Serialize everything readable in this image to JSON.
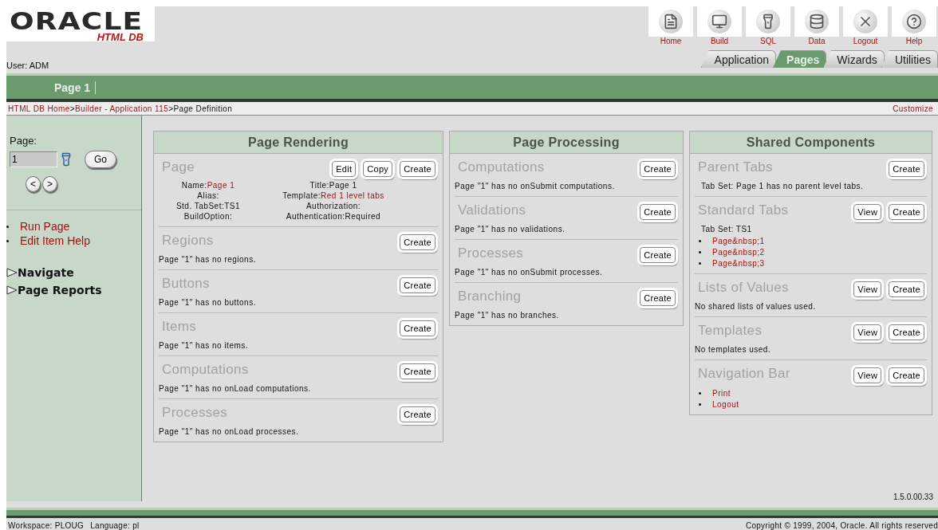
{
  "logo": {
    "word": "ORACLE",
    "product": "HTML DB"
  },
  "user": "User: ADM",
  "toolbar": [
    {
      "label": "Home"
    },
    {
      "label": "Build"
    },
    {
      "label": "SQL"
    },
    {
      "label": "Data"
    },
    {
      "label": "Logout"
    },
    {
      "label": "Help"
    }
  ],
  "tabs": [
    {
      "label": "Application",
      "selected": false
    },
    {
      "label": "Pages",
      "selected": true
    },
    {
      "label": "Wizards",
      "selected": false
    },
    {
      "label": "Utilities",
      "selected": false
    }
  ],
  "page_tab": "Page 1",
  "breadcrumb": [
    {
      "label": "HTML DB Home",
      "link": true
    },
    {
      "label": ">",
      "link": false
    },
    {
      "label": "Builder - Application 115",
      "link": true
    },
    {
      "label": ">Page Definition",
      "link": false
    }
  ],
  "customize": "Customize",
  "sidebar": {
    "page_label": "Page:",
    "page_value": "1",
    "go": "Go",
    "prev": "<",
    "next": ">",
    "links": [
      "Run Page",
      "Edit Item Help"
    ],
    "sections": [
      {
        "label": "Navigate",
        "expanded": false
      },
      {
        "label": "Page Reports",
        "expanded": false
      }
    ]
  },
  "panels": [
    {
      "title": "Page Rendering",
      "sections": [
        {
          "title": "Page",
          "buttons": [
            "Edit",
            "Copy",
            "Create"
          ],
          "fields": [
            {
              "label": "Name:",
              "value": "Page 1",
              "link": true
            },
            {
              "label": "Title:",
              "value": "Page 1",
              "link": false
            },
            {
              "label": "Alias:"
            },
            {
              "label": "Template:",
              "value": "Red 1 level tabs",
              "link": true
            },
            {
              "label": "Std. TabSet:",
              "value": "TS1",
              "link": false
            },
            {
              "label": "Authorization:"
            },
            {
              "label": "BuildOption:"
            },
            {
              "label": "Authentication:",
              "value": "Required",
              "link": false
            }
          ]
        },
        {
          "title": "Regions",
          "buttons": [
            "Create"
          ],
          "text": "Page \"1\" has no regions."
        },
        {
          "title": "Buttons",
          "buttons": [
            "Create"
          ],
          "text": "Page \"1\" has no buttons."
        },
        {
          "title": "Items",
          "buttons": [
            "Create"
          ],
          "text": "Page \"1\" has no items."
        },
        {
          "title": "Computations",
          "buttons": [
            "Create"
          ],
          "text": "Page \"1\" has no onLoad computations."
        },
        {
          "title": "Processes",
          "buttons": [
            "Create"
          ],
          "text": "Page \"1\" has no onLoad processes."
        }
      ]
    },
    {
      "title": "Page Processing",
      "sections": [
        {
          "title": "Computations",
          "buttons": [
            "Create"
          ],
          "text": "Page \"1\" has no onSubmit computations."
        },
        {
          "title": "Validations",
          "buttons": [
            "Create"
          ],
          "text": "Page \"1\" has no validations."
        },
        {
          "title": "Processes",
          "buttons": [
            "Create"
          ],
          "text": "Page \"1\" has no onSubmit processes."
        },
        {
          "title": "Branching",
          "buttons": [
            "Create"
          ],
          "text": "Page \"1\" has no branches."
        }
      ]
    },
    {
      "title": "Shared Components",
      "sections": [
        {
          "title": "Parent Tabs",
          "buttons": [
            "Create"
          ],
          "text": "Tab Set: Page 1 has no parent level tabs.",
          "indent": true
        },
        {
          "title": "Standard Tabs",
          "buttons": [
            "View",
            "Create"
          ],
          "text": "Tab Set: TS1",
          "indent": true,
          "links": [
            "Page&nbsp;1",
            "Page&nbsp;2",
            "Page&nbsp;3"
          ]
        },
        {
          "title": "Lists of Values",
          "buttons": [
            "View",
            "Create"
          ],
          "text": "No shared lists of values used."
        },
        {
          "title": "Templates",
          "buttons": [
            "View",
            "Create"
          ],
          "text": "No templates used."
        },
        {
          "title": "Navigation Bar",
          "buttons": [
            "View",
            "Create"
          ],
          "links": [
            "Print",
            "Logout"
          ]
        }
      ]
    }
  ],
  "version": "1.5.0.00.33",
  "footer": {
    "workspace": "Workspace: PLOUG",
    "language": "Language: pl",
    "copyright": "Copyright © 1999, 2004, Oracle. All rights reserved"
  }
}
